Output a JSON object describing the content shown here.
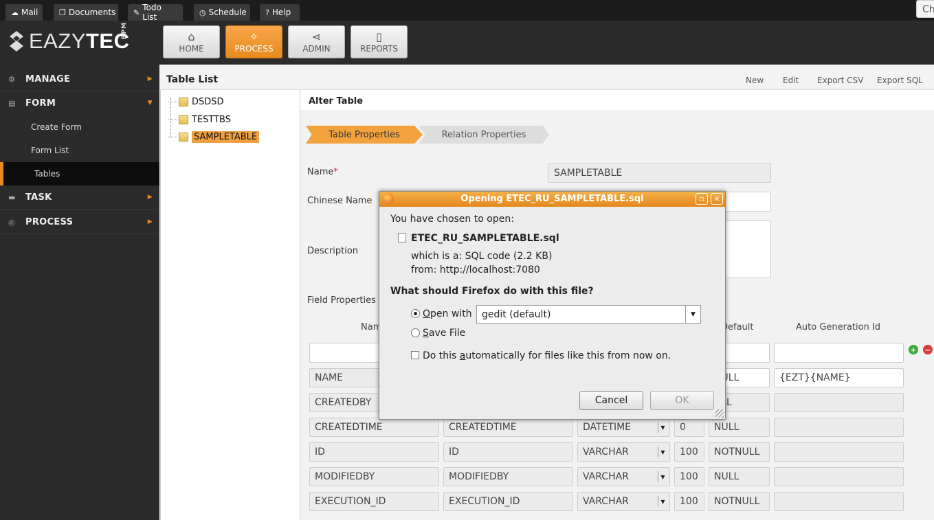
{
  "topbar": {
    "links": [
      {
        "label": "Mail",
        "icon": "cloud-icon"
      },
      {
        "label": "Documents",
        "icon": "documents-icon"
      },
      {
        "label": "Todo List",
        "icon": "pin-icon"
      },
      {
        "label": "Schedule",
        "icon": "clock-icon"
      },
      {
        "label": "Help",
        "icon": "help-icon"
      }
    ],
    "right_text": "Ch"
  },
  "brand": {
    "name_light": "EAZY",
    "name_bold": "TEC",
    "sub": "BPM"
  },
  "nav": [
    {
      "label": "HOME",
      "icon": "home-icon"
    },
    {
      "label": "PROCESS",
      "icon": "wand-icon",
      "active": true
    },
    {
      "label": "ADMIN",
      "icon": "share-icon"
    },
    {
      "label": "REPORTS",
      "icon": "clipboard-icon"
    }
  ],
  "sidebar": {
    "manage": "MANAGE",
    "form": "FORM",
    "form_items": [
      "Create Form",
      "Form List",
      "Tables"
    ],
    "task": "TASK",
    "process": "PROCESS"
  },
  "content": {
    "title": "Table List",
    "actions": [
      "New",
      "Edit",
      "Export CSV",
      "Export SQL"
    ]
  },
  "tree": [
    "DSDSD",
    "TESTTBS",
    "SAMPLETABLE"
  ],
  "alter": {
    "title": "Alter Table",
    "steps": [
      "Table Properties",
      "Relation Properties"
    ],
    "name_label": "Name",
    "name_value": "SAMPLETABLE",
    "chinese_label": "Chinese Name",
    "description_label": "Description",
    "field_props_label": "Field Properties",
    "col_name": "Nam",
    "col_default": "Default",
    "col_autogen": "Auto Generation Id",
    "rows": [
      {
        "name": "NAME",
        "cname": "",
        "type": "",
        "len": "",
        "nul": "NULL",
        "auto": "{EZT}{NAME}"
      },
      {
        "name": "CREATEDBY",
        "cname": "",
        "type": "",
        "len": "",
        "nul": "ULL",
        "auto": ""
      },
      {
        "name": "CREATEDTIME",
        "cname": "CREATEDTIME",
        "type": "DATETIME",
        "len": "0",
        "nul": "NULL",
        "auto": ""
      },
      {
        "name": "ID",
        "cname": "ID",
        "type": "VARCHAR",
        "len": "100",
        "nul": "NOTNULL",
        "auto": ""
      },
      {
        "name": "MODIFIEDBY",
        "cname": "MODIFIEDBY",
        "type": "VARCHAR",
        "len": "100",
        "nul": "NULL",
        "auto": ""
      },
      {
        "name": "EXECUTION_ID",
        "cname": "EXECUTION_ID",
        "type": "VARCHAR",
        "len": "100",
        "nul": "NOTNULL",
        "auto": ""
      }
    ]
  },
  "dialog": {
    "title": "Opening ETEC_RU_SAMPLETABLE.sql",
    "chosen": "You have chosen to open:",
    "filename": "ETEC_RU_SAMPLETABLE.sql",
    "which_is": "which is a:  SQL code (2.2 KB)",
    "from": "from:  http://localhost:7080",
    "question": "What should Firefox do with this file?",
    "open_with_pre": "O",
    "open_with_post": "pen with",
    "app": "gedit (default)",
    "save_pre": "S",
    "save_post": "ave File",
    "auto_pre": "Do this ",
    "auto_u": "a",
    "auto_post": "utomatically for files like this from now on.",
    "cancel": "Cancel",
    "ok": "OK"
  },
  "colors": {
    "accent": "#e88a1e",
    "dark": "#2b2b2b"
  }
}
